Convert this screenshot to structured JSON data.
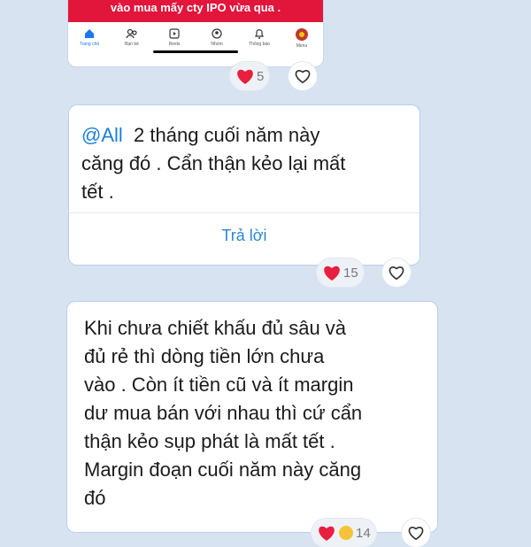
{
  "screenshot": {
    "banner_text": "vào mua mấy cty IPO vừa qua .",
    "nav": [
      {
        "label": "Trang chủ",
        "icon": "home-icon"
      },
      {
        "label": "Bạn bè",
        "icon": "friends-icon"
      },
      {
        "label": "Reels",
        "icon": "reels-icon"
      },
      {
        "label": "Nhóm",
        "icon": "groups-icon"
      },
      {
        "label": "Thông báo",
        "icon": "bell-icon"
      },
      {
        "label": "Menu",
        "icon": "avatar-icon"
      }
    ]
  },
  "messages": [
    {
      "reaction_count": "5"
    },
    {
      "mention": "@All",
      "text_lines": [
        "2 tháng cuối năm này",
        "căng đó . Cẩn thận kẻo lại mất",
        "tết ."
      ],
      "reply_label": "Trả lời",
      "reaction_count": "15"
    },
    {
      "text_lines": [
        "Khi chưa chiết khấu đủ sâu và",
        "đủ rẻ thì dòng tiền lớn chưa",
        "vào . Còn ít tiền cũ và ít margin",
        "dư  mua bán với nhau thì cứ cẩn",
        "thận kẻo sụp phát là mất tết .",
        "Margin đoạn cuối năm này căng",
        "đó"
      ],
      "reaction_count": "14"
    }
  ],
  "colors": {
    "heart": "#e8203f",
    "mention": "#1a7fd6",
    "banner": "#e2153b"
  }
}
